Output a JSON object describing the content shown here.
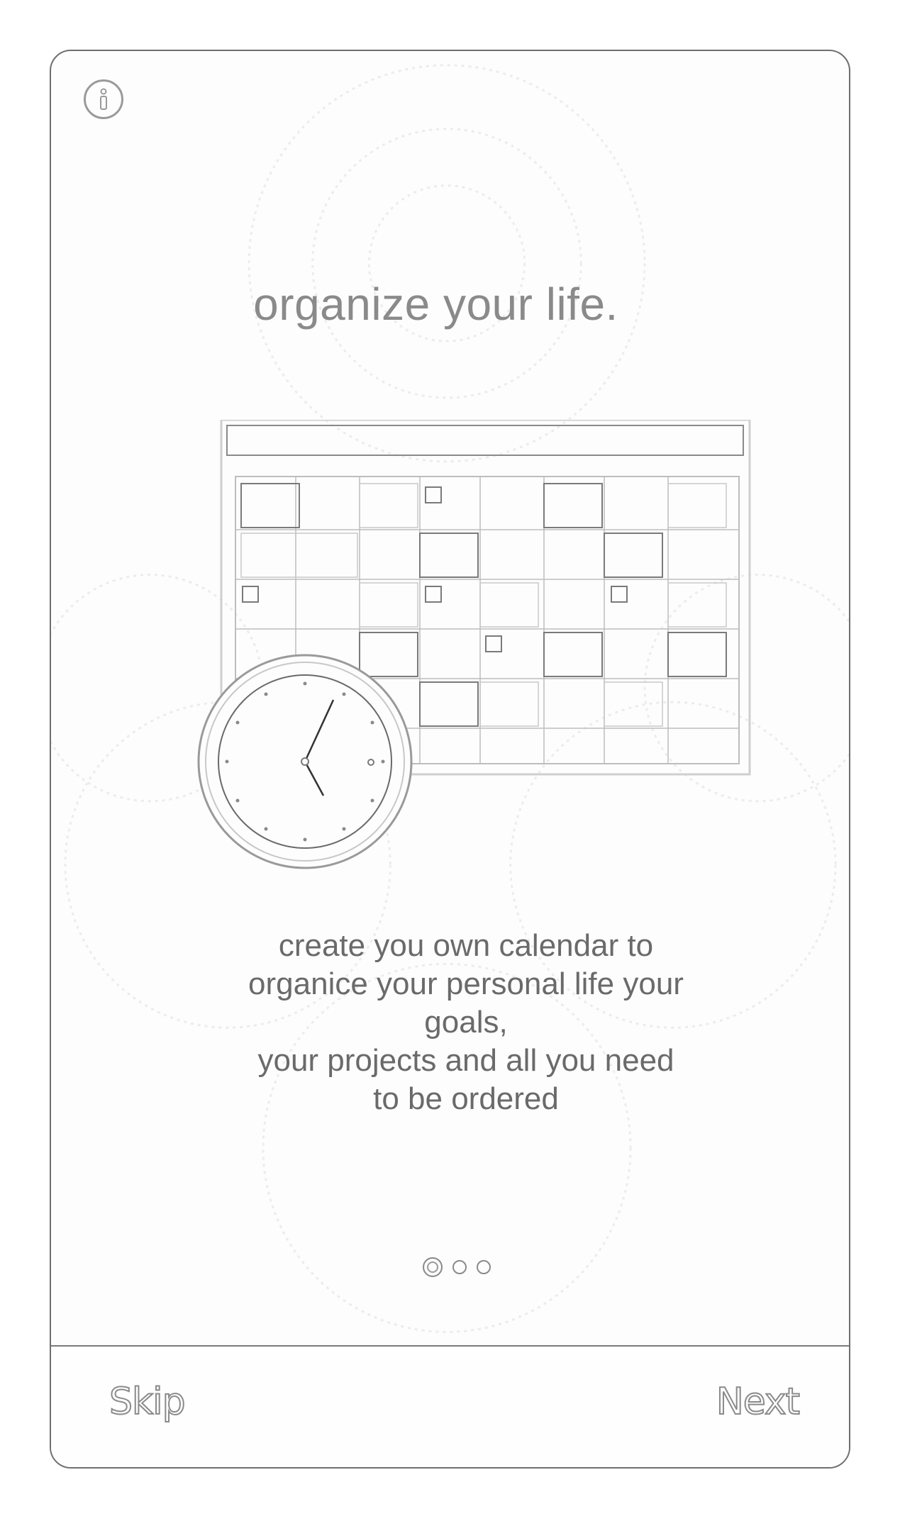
{
  "headline": "organize your life.",
  "description": "create you own calendar to\norganice your personal life your\ngoals,\nyour projects and  all you need\nto be ordered",
  "pager": {
    "total": 3,
    "active_index": 0
  },
  "footer": {
    "skip_label": "Skip",
    "next_label": "Next"
  },
  "icons": {
    "info": "info-icon",
    "illustration_calendar": "calendar-icon",
    "illustration_clock": "clock-icon"
  },
  "clock": {
    "hour_hand_time": "5",
    "minute_hand_time": "5"
  }
}
